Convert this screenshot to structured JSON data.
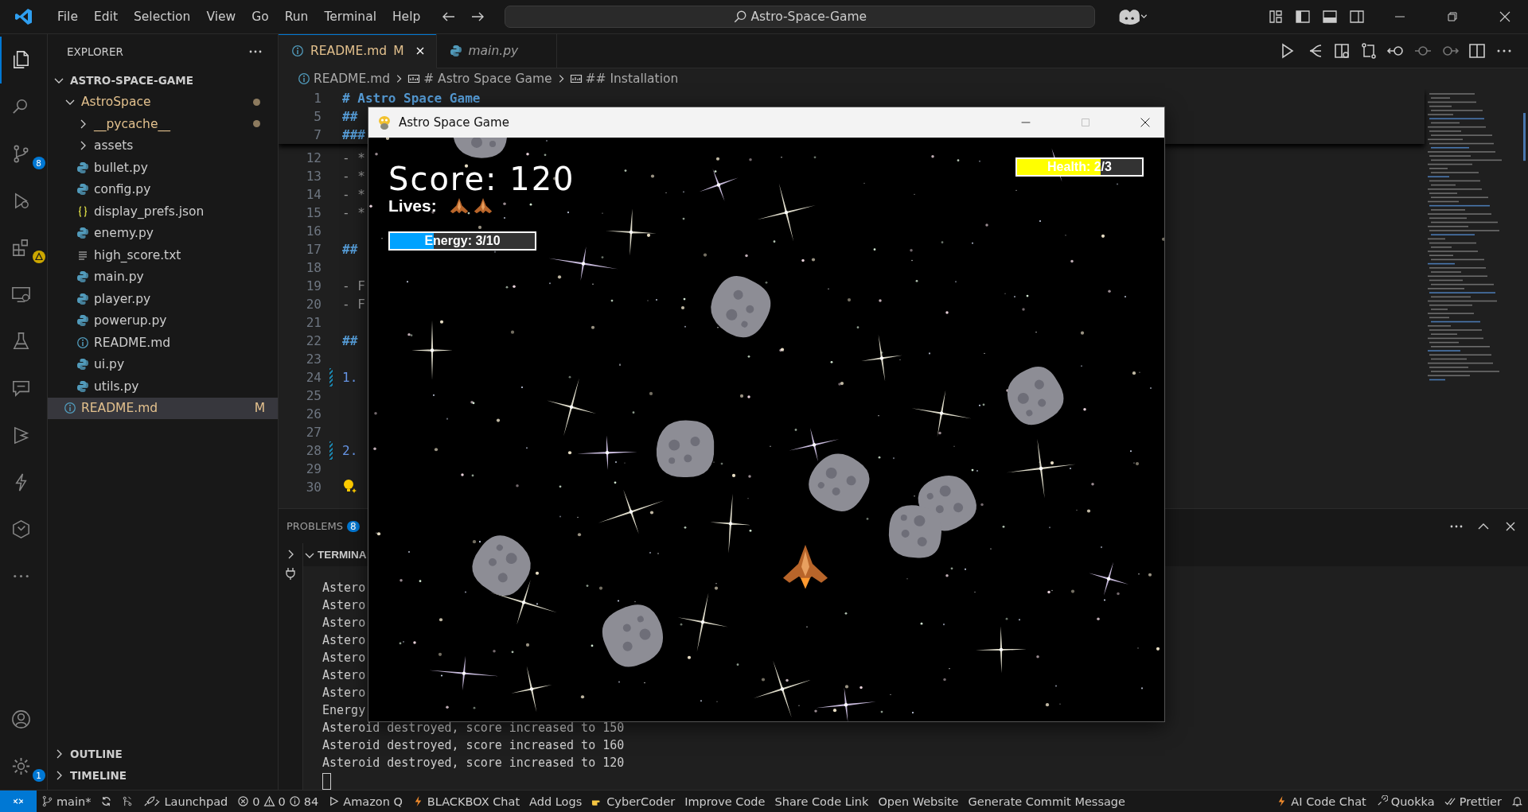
{
  "title_bar": {
    "menu": [
      "File",
      "Edit",
      "Selection",
      "View",
      "Go",
      "Run",
      "Terminal",
      "Help"
    ],
    "search": "Astro-Space-Game"
  },
  "activity_bar": {
    "source_control_badge": "8",
    "extensions_warning": true,
    "settings_badge": "1"
  },
  "sidebar": {
    "title": "EXPLORER",
    "root": {
      "label": "ASTRO-SPACE-GAME",
      "expanded": true
    },
    "tree": [
      {
        "label": "AstroSpace",
        "kind": "folder",
        "expanded": true,
        "modified": true,
        "selected": false,
        "children": [
          {
            "label": "__pycache__",
            "kind": "folder",
            "expanded": false,
            "modified": true,
            "selected": false
          },
          {
            "label": "assets",
            "kind": "folder",
            "expanded": false,
            "modified": false,
            "selected": false
          },
          {
            "label": "bullet.py",
            "kind": "python",
            "modified": false,
            "selected": false
          },
          {
            "label": "config.py",
            "kind": "python",
            "modified": false,
            "selected": false
          },
          {
            "label": "display_prefs.json",
            "kind": "json",
            "modified": false,
            "selected": false
          },
          {
            "label": "enemy.py",
            "kind": "python",
            "modified": false,
            "selected": false
          },
          {
            "label": "high_score.txt",
            "kind": "text",
            "modified": false,
            "selected": false
          },
          {
            "label": "main.py",
            "kind": "python",
            "modified": false,
            "selected": false
          },
          {
            "label": "player.py",
            "kind": "python",
            "modified": false,
            "selected": false
          },
          {
            "label": "powerup.py",
            "kind": "python",
            "modified": false,
            "selected": false
          },
          {
            "label": "README.md",
            "kind": "markdown",
            "modified": false,
            "selected": false
          },
          {
            "label": "ui.py",
            "kind": "python",
            "modified": false,
            "selected": false
          },
          {
            "label": "utils.py",
            "kind": "python",
            "modified": false,
            "selected": false
          }
        ]
      },
      {
        "label": "README.md",
        "kind": "markdown",
        "status": "M",
        "modified": false,
        "selected": true
      }
    ],
    "sections": [
      {
        "label": "OUTLINE",
        "expanded": false
      },
      {
        "label": "TIMELINE",
        "expanded": false
      }
    ]
  },
  "tabs": [
    {
      "label": "README.md",
      "kind": "markdown",
      "badge": "M",
      "selected": true
    },
    {
      "label": "main.py",
      "kind": "python",
      "selected": false
    }
  ],
  "breadcrumbs": [
    {
      "label": "README.md",
      "kind": "markdown"
    },
    {
      "label": "# Astro Space Game",
      "kind": "symbol"
    },
    {
      "label": "## Installation",
      "kind": "symbol"
    }
  ],
  "editor": {
    "sticky_lines": [
      {
        "number": "1",
        "text": "# Astro Space Game",
        "kind": "heading"
      },
      {
        "number": "5",
        "text": "##",
        "kind": "heading"
      },
      {
        "number": "7",
        "text": "###",
        "kind": "heading"
      }
    ],
    "lines": [
      {
        "number": "12",
        "text": "- *",
        "kind": "list",
        "changed": false
      },
      {
        "number": "13",
        "text": "- *",
        "kind": "list",
        "changed": false
      },
      {
        "number": "14",
        "text": "- *",
        "kind": "list",
        "changed": false
      },
      {
        "number": "15",
        "text": "- *",
        "kind": "list",
        "changed": false
      },
      {
        "number": "16",
        "kind": "blank",
        "changed": false
      },
      {
        "number": "17",
        "text": "##",
        "kind": "heading",
        "changed": false
      },
      {
        "number": "18",
        "kind": "blank",
        "changed": false
      },
      {
        "number": "19",
        "text": "- F",
        "kind": "list",
        "changed": false
      },
      {
        "number": "20",
        "text": "- F",
        "kind": "list",
        "changed": false
      },
      {
        "number": "21",
        "kind": "blank",
        "changed": false
      },
      {
        "number": "22",
        "text": "##",
        "kind": "heading",
        "changed": false
      },
      {
        "number": "23",
        "kind": "blank",
        "changed": false
      },
      {
        "number": "24",
        "text": "1.",
        "kind": "numbered",
        "changed": true
      },
      {
        "number": "25",
        "kind": "blank",
        "changed": false
      },
      {
        "number": "26",
        "kind": "blank",
        "changed": false
      },
      {
        "number": "27",
        "kind": "blank",
        "changed": false
      },
      {
        "number": "28",
        "text": "2.",
        "kind": "numbered",
        "changed": true
      },
      {
        "number": "29",
        "kind": "blank",
        "changed": false
      },
      {
        "number": "30",
        "kind": "lightbulb",
        "changed": false
      }
    ]
  },
  "panel": {
    "tabs": [
      {
        "label": "PROBLEMS",
        "badge": "8",
        "selected": false
      }
    ],
    "terminal": {
      "title": "TERMINA",
      "expanded": true
    },
    "terminal_lines": [
      "Astero",
      "Astero",
      "Astero",
      "Astero",
      "Astero",
      "Astero",
      "Astero",
      "Energy",
      "Asteroid destroyed, score increased to 150",
      "Asteroid destroyed, score increased to 160",
      "Asteroid destroyed, score increased to 120"
    ]
  },
  "game_window": {
    "title": "Astro Space Game",
    "score": "Score: 120",
    "lives_label": "Lives:",
    "lives": [
      {
        "kind": "ship"
      },
      {
        "kind": "ship"
      }
    ],
    "energy": {
      "label": "Energy: 3/10",
      "level": 0.3
    },
    "health": {
      "label": "Health: 2/3",
      "level": 0.67
    }
  },
  "status_bar": {
    "left": [
      {
        "kind": "branch",
        "text": "main*"
      },
      {
        "kind": "sync"
      },
      {
        "kind": "graph"
      },
      {
        "kind": "launchpad",
        "text": "Launchpad"
      },
      {
        "kind": "problems",
        "errors": "0",
        "warnings": "0",
        "info": "84"
      },
      {
        "kind": "play",
        "text": "Amazon Q"
      },
      {
        "kind": "flame",
        "text": "BLACKBOX Chat"
      },
      {
        "kind": "plain",
        "text": "Add Logs"
      },
      {
        "kind": "hand",
        "text": "CyberCoder"
      },
      {
        "kind": "plain",
        "text": "Improve Code"
      },
      {
        "kind": "plain",
        "text": "Share Code Link"
      },
      {
        "kind": "plain",
        "text": "Open Website"
      },
      {
        "kind": "plain",
        "text": "Generate Commit Message"
      }
    ],
    "right": [
      {
        "kind": "flame",
        "text": "AI Code Chat"
      },
      {
        "kind": "quokka",
        "text": "Quokka"
      },
      {
        "kind": "check",
        "text": "Prettier"
      },
      {
        "kind": "bell"
      }
    ]
  }
}
